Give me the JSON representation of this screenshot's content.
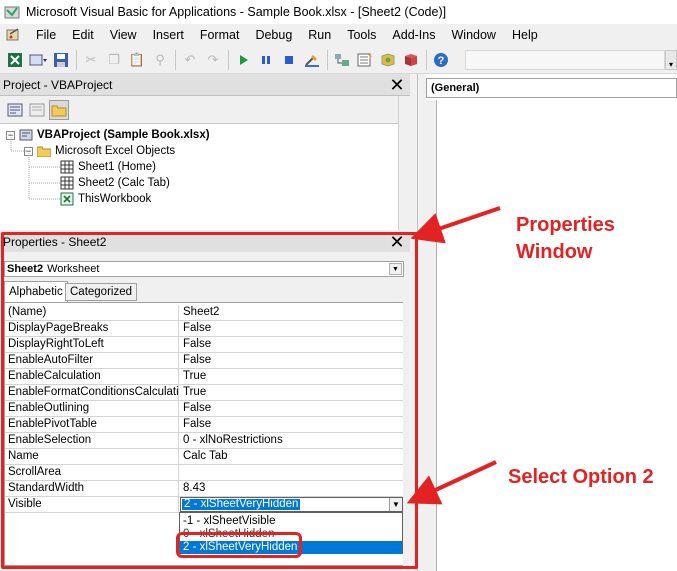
{
  "window": {
    "title": "Microsoft Visual Basic for Applications - Sample Book.xlsx - [Sheet2 (Code)]"
  },
  "menubar": {
    "items": [
      "File",
      "Edit",
      "View",
      "Insert",
      "Format",
      "Debug",
      "Run",
      "Tools",
      "Add-Ins",
      "Window",
      "Help"
    ]
  },
  "toolbar": {
    "icons": [
      "excel-icon",
      "insert-module-icon",
      "save-icon",
      "cut-icon",
      "copy-icon",
      "paste-icon",
      "find-icon",
      "undo-icon",
      "redo-icon",
      "run-icon",
      "break-icon",
      "reset-icon",
      "design-mode-icon",
      "project-explorer-icon",
      "properties-icon",
      "object-browser-icon",
      "toolbox-icon",
      "help-icon"
    ]
  },
  "project_pane": {
    "title": "Project - VBAProject",
    "tree": {
      "root": "VBAProject (Sample Book.xlsx)",
      "folder": "Microsoft Excel Objects",
      "items": [
        "Sheet1 (Home)",
        "Sheet2 (Calc Tab)",
        "ThisWorkbook"
      ]
    }
  },
  "properties_pane": {
    "title": "Properties - Sheet2",
    "object_name": "Sheet2",
    "object_type": "Worksheet",
    "tabs": [
      "Alphabetic",
      "Categorized"
    ],
    "rows": [
      {
        "name": "(Name)",
        "value": "Sheet2"
      },
      {
        "name": "DisplayPageBreaks",
        "value": "False"
      },
      {
        "name": "DisplayRightToLeft",
        "value": "False"
      },
      {
        "name": "EnableAutoFilter",
        "value": "False"
      },
      {
        "name": "EnableCalculation",
        "value": "True"
      },
      {
        "name": "EnableFormatConditionsCalculation",
        "value": "True"
      },
      {
        "name": "EnableOutlining",
        "value": "False"
      },
      {
        "name": "EnablePivotTable",
        "value": "False"
      },
      {
        "name": "EnableSelection",
        "value": "0 - xlNoRestrictions"
      },
      {
        "name": "Name",
        "value": "Calc Tab"
      },
      {
        "name": "ScrollArea",
        "value": ""
      },
      {
        "name": "StandardWidth",
        "value": "8.43"
      },
      {
        "name": "Visible",
        "value": "2 - xlSheetVeryHidden"
      }
    ],
    "visible_options": [
      "-1 - xlSheetVisible",
      "0 - xlSheetHidden",
      "2 - xlSheetVeryHidden"
    ]
  },
  "code_window": {
    "object_combo": "(General)"
  },
  "annotations": {
    "properties_label_line1": "Properties",
    "properties_label_line2": "Window",
    "option_label": "Select Option 2",
    "color": "#e32222"
  }
}
